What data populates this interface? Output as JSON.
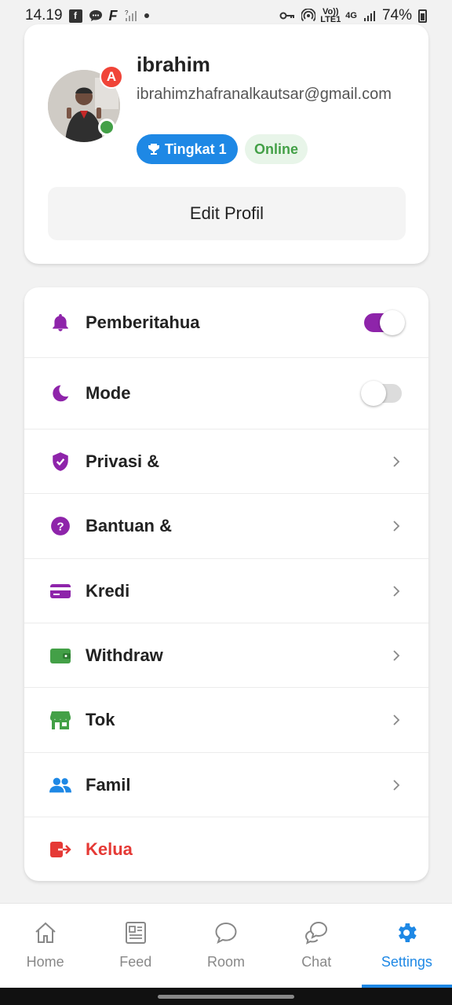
{
  "status_bar": {
    "time": "14.19",
    "battery": "74%",
    "network": "4G",
    "volte": "Vo)) LTE1"
  },
  "profile": {
    "name": "ibrahim",
    "email": "ibrahimzhafranalkautsar@gmail.com",
    "avatar_badge": "A",
    "level_label": "Tingkat 1",
    "status_label": "Online",
    "edit_button": "Edit Profil"
  },
  "settings": {
    "items": [
      {
        "label": "Pemberitahua",
        "icon": "bell-icon",
        "color": "#8e24aa",
        "control": "toggle",
        "toggle_on": true
      },
      {
        "label": "Mode",
        "icon": "moon-icon",
        "color": "#8e24aa",
        "control": "toggle",
        "toggle_on": false
      },
      {
        "label": "Privasi &",
        "icon": "shield-icon",
        "color": "#8e24aa",
        "control": "chevron"
      },
      {
        "label": "Bantuan &",
        "icon": "help-icon",
        "color": "#8e24aa",
        "control": "chevron"
      },
      {
        "label": "Kredi",
        "icon": "credit-card-icon",
        "color": "#8e24aa",
        "control": "chevron"
      },
      {
        "label": "Withdraw",
        "icon": "wallet-icon",
        "color": "#43a047",
        "control": "chevron"
      },
      {
        "label": "Tok",
        "icon": "store-icon",
        "color": "#43a047",
        "control": "chevron"
      },
      {
        "label": "Famil",
        "icon": "people-icon",
        "color": "#1e88e5",
        "control": "chevron"
      },
      {
        "label": "Kelua",
        "icon": "logout-icon",
        "color": "#e53935",
        "control": "none"
      }
    ]
  },
  "bottom_nav": {
    "items": [
      {
        "label": "Home",
        "icon": "home-icon"
      },
      {
        "label": "Feed",
        "icon": "feed-icon"
      },
      {
        "label": "Room",
        "icon": "room-chat-bubble-icon"
      },
      {
        "label": "Chat",
        "icon": "chat-bubbles-icon"
      },
      {
        "label": "Settings",
        "icon": "gear-icon",
        "active": true
      }
    ]
  },
  "colors": {
    "accent_blue": "#1e88e5",
    "accent_purple": "#8e24aa",
    "success_green": "#43a047",
    "danger_red": "#e53935"
  }
}
